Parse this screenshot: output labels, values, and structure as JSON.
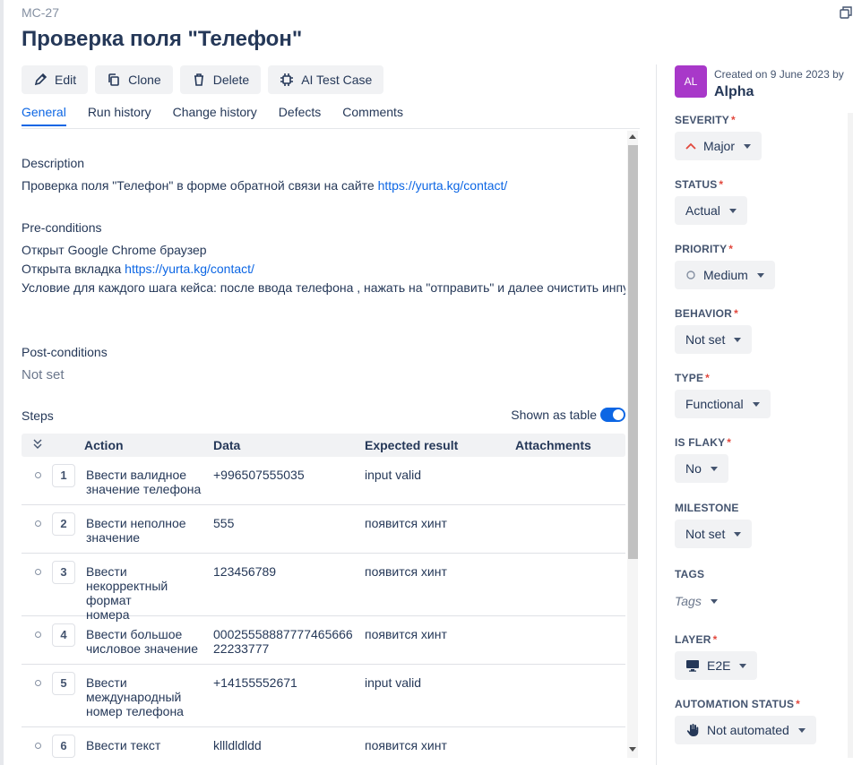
{
  "case_id": "MC-27",
  "title": "Проверка поля \"Телефон\"",
  "toolbar": {
    "edit": "Edit",
    "clone": "Clone",
    "delete": "Delete",
    "ai": "AI Test Case"
  },
  "tabs": [
    "General",
    "Run history",
    "Change history",
    "Defects",
    "Comments"
  ],
  "description": {
    "label": "Description",
    "text": "Проверка поля \"Телефон\" в форме обратной связи на сайте ",
    "link": "https://yurta.kg/contact/"
  },
  "preconditions": {
    "label": "Pre-conditions",
    "line1": "Открыт Google Chrome браузер",
    "line2_text": "Открыта вкладка ",
    "line2_link": "https://yurta.kg/contact/",
    "line3": "Условие для каждого шага кейса: после ввода телефона , нажать на \"отправить\" и далее очистить инпут"
  },
  "postconditions": {
    "label": "Post-conditions",
    "value": "Not set"
  },
  "steps": {
    "label": "Steps",
    "toggle_label": "Shown as table",
    "columns": {
      "action": "Action",
      "data": "Data",
      "expected": "Expected result",
      "attachments": "Attachments"
    },
    "rows": [
      {
        "num": "1",
        "action": "Ввести валидное значение телефона",
        "data": "+996507555035",
        "expected": "input valid"
      },
      {
        "num": "2",
        "action": "Ввести неполное значение",
        "data": "555",
        "expected": "появится хинт"
      },
      {
        "num": "3",
        "action": "Ввести некорректный формат номера",
        "data": "123456789",
        "expected": "появится хинт"
      },
      {
        "num": "4",
        "action": "Ввести большое числовое значение",
        "data": "0002555888777746566622233777",
        "expected": "появится хинт"
      },
      {
        "num": "5",
        "action": "Ввести международный номер телефона",
        "data": "+14155552671",
        "expected": "input valid"
      },
      {
        "num": "6",
        "action": "Ввести текст",
        "data": "kllldldldd",
        "expected": "появится хинт"
      }
    ]
  },
  "sidebar": {
    "avatar_initials": "AL",
    "avatar_color": "#a838c9",
    "created": "Created on 9 June 2023 by",
    "author": "Alpha",
    "severity": {
      "label": "SEVERITY",
      "value": "Major",
      "icon": "chevron-up-icon",
      "icon_color": "#e2483d"
    },
    "status": {
      "label": "STATUS",
      "value": "Actual"
    },
    "priority": {
      "label": "PRIORITY",
      "value": "Medium",
      "icon": "circle-icon"
    },
    "behavior": {
      "label": "BEHAVIOR",
      "value": "Not set"
    },
    "type": {
      "label": "TYPE",
      "value": "Functional"
    },
    "is_flaky": {
      "label": "IS FLAKY",
      "value": "No"
    },
    "milestone": {
      "label": "MILESTONE",
      "value": "Not set"
    },
    "tags": {
      "label": "TAGS",
      "placeholder": "Tags"
    },
    "layer": {
      "label": "LAYER",
      "value": "E2E",
      "icon": "monitor-icon"
    },
    "automation": {
      "label": "AUTOMATION STATUS",
      "value": "Not automated",
      "icon": "hand-icon"
    }
  },
  "accent_color": "#0c66e4"
}
